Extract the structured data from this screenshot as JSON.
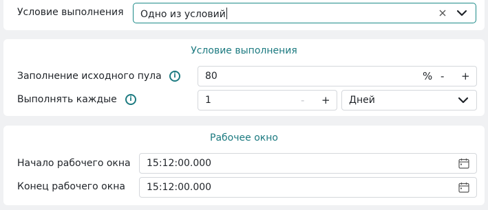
{
  "condition": {
    "label": "Условие выполнения",
    "value": "Одно из условий",
    "clear_icon": "close-icon",
    "dropdown_icon": "chevron-down-icon"
  },
  "execution_condition": {
    "title": "Условие выполнения",
    "pool_fill": {
      "label": "Заполнение исходного пула",
      "info_icon": "info-icon",
      "value": "80",
      "unit": "%",
      "decrement": "-",
      "increment": "+"
    },
    "run_every": {
      "label": "Выполнять каждые",
      "info_icon": "info-icon",
      "value": "1",
      "decrement": "-",
      "increment": "+",
      "period": "Дней"
    }
  },
  "work_window": {
    "title": "Рабочее окно",
    "start": {
      "label": "Начало рабочего окна",
      "value": "15:12:00.000",
      "icon": "calendar-icon"
    },
    "end": {
      "label": "Конец рабочего окна",
      "value": "15:12:00.000",
      "icon": "calendar-icon"
    }
  },
  "colors": {
    "accent": "#1c7a80",
    "border": "#d4d7db",
    "background": "#f0f1f3"
  }
}
